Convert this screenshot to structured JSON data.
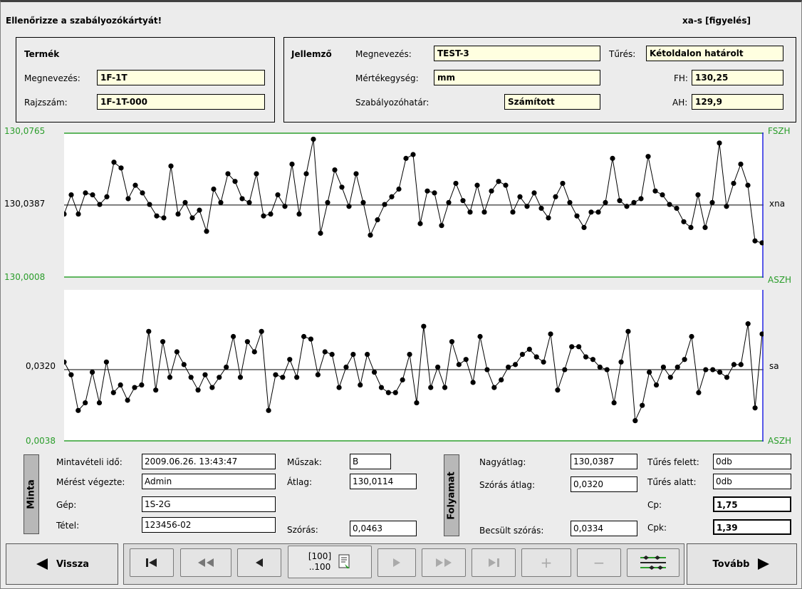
{
  "header": {
    "title": "Ellenőrizze a szabályozókártyát!",
    "mode": "xa-s [figyelés]"
  },
  "product": {
    "heading": "Termék",
    "name_label": "Megnevezés:",
    "name_value": "1F-1T",
    "drawing_label": "Rajzszám:",
    "drawing_value": "1F-1T-000"
  },
  "characteristic": {
    "heading": "Jellemző",
    "name_label": "Megnevezés:",
    "name_value": "TEST-3",
    "unit_label": "Mértékegység:",
    "unit_value": "mm",
    "limit_label": "Szabályozóhatár:",
    "limit_value": "Számított",
    "tolerance_label": "Tűrés:",
    "tolerance_value": "Kétoldalon határolt",
    "fh_label": "FH:",
    "fh_value": "130,25",
    "ah_label": "AH:",
    "ah_value": "129,9"
  },
  "charts": {
    "xbar": {
      "top_label": "130,0765",
      "mid_label": "130,0387",
      "bottom_label": "130,0008",
      "right_top": "FSZH",
      "right_mid": "xna",
      "right_bottom": "ASZH"
    },
    "s": {
      "mid_label": "0,0320",
      "bottom_label": "0,0038",
      "right_mid": "sa",
      "right_bottom": "ASZH"
    }
  },
  "chart_data": [
    {
      "type": "line",
      "ylim": [
        130.0008,
        130.0765
      ],
      "centerline": 130.0387,
      "values": [
        130.034,
        130.044,
        130.034,
        130.045,
        130.044,
        130.039,
        130.043,
        130.061,
        130.058,
        130.042,
        130.049,
        130.045,
        130.039,
        130.033,
        130.032,
        130.059,
        130.034,
        130.04,
        130.032,
        130.036,
        130.025,
        130.047,
        130.04,
        130.055,
        130.051,
        130.042,
        130.04,
        130.055,
        130.033,
        130.034,
        130.044,
        130.038,
        130.06,
        130.034,
        130.055,
        130.073,
        130.024,
        130.04,
        130.057,
        130.048,
        130.038,
        130.055,
        130.04,
        130.023,
        130.031,
        130.039,
        130.043,
        130.047,
        130.063,
        130.065,
        130.029,
        130.046,
        130.045,
        130.028,
        130.04,
        130.05,
        130.041,
        130.035,
        130.049,
        130.035,
        130.046,
        130.051,
        130.049,
        130.035,
        130.043,
        130.038,
        130.045,
        130.037,
        130.032,
        130.043,
        130.05,
        130.04,
        130.033,
        130.027,
        130.035,
        130.035,
        130.04,
        130.063,
        130.041,
        130.038,
        130.04,
        130.042,
        130.064,
        130.046,
        130.044,
        130.039,
        130.037,
        130.03,
        130.027,
        130.044,
        130.027,
        130.04,
        130.071,
        130.038,
        130.05,
        130.06,
        130.049,
        130.02,
        130.019
      ]
    },
    {
      "type": "line",
      "ylim": [
        0.0038,
        0.0633
      ],
      "centerline": 0.032,
      "values": [
        0.035,
        0.03,
        0.016,
        0.019,
        0.031,
        0.019,
        0.035,
        0.023,
        0.026,
        0.02,
        0.025,
        0.026,
        0.047,
        0.024,
        0.043,
        0.029,
        0.039,
        0.034,
        0.029,
        0.024,
        0.03,
        0.025,
        0.029,
        0.033,
        0.045,
        0.029,
        0.043,
        0.039,
        0.047,
        0.016,
        0.03,
        0.029,
        0.036,
        0.029,
        0.045,
        0.044,
        0.03,
        0.039,
        0.038,
        0.025,
        0.033,
        0.038,
        0.026,
        0.038,
        0.031,
        0.025,
        0.023,
        0.023,
        0.028,
        0.038,
        0.019,
        0.049,
        0.025,
        0.033,
        0.025,
        0.043,
        0.034,
        0.036,
        0.027,
        0.045,
        0.032,
        0.025,
        0.028,
        0.033,
        0.034,
        0.038,
        0.04,
        0.037,
        0.035,
        0.046,
        0.024,
        0.032,
        0.041,
        0.041,
        0.037,
        0.036,
        0.033,
        0.032,
        0.019,
        0.035,
        0.047,
        0.012,
        0.018,
        0.031,
        0.026,
        0.033,
        0.029,
        0.033,
        0.036,
        0.045,
        0.023,
        0.032,
        0.032,
        0.031,
        0.029,
        0.034,
        0.034,
        0.05,
        0.017,
        0.046
      ]
    }
  ],
  "sample": {
    "tab_label": "Minta",
    "time_label": "Mintavételi idő:",
    "time_value": "2009.06.26. 13:43:47",
    "operator_label": "Mérést végezte:",
    "operator_value": "Admin",
    "machine_label": "Gép:",
    "machine_value": "1S-2G",
    "lot_label": "Tétel:",
    "lot_value": "123456-02",
    "shift_label": "Műszak:",
    "shift_value": "B",
    "mean_label": "Átlag:",
    "mean_value": "130,0114",
    "std_label": "Szórás:",
    "std_value": "0,0463"
  },
  "process": {
    "tab_label": "Folyamat",
    "grand_mean_label": "Nagyátlag:",
    "grand_mean_value": "130,0387",
    "std_mean_label": "Szórás átlag:",
    "std_mean_value": "0,0320",
    "est_std_label": "Becsült szórás:",
    "est_std_value": "0,0334",
    "over_label": "Tűrés felett:",
    "over_value": "0db",
    "under_label": "Tűrés alatt:",
    "under_value": "0db",
    "cp_label": "Cp:",
    "cp_value": "1,75",
    "cpk_label": "Cpk:",
    "cpk_value": "1,39"
  },
  "nav": {
    "back_label": "Vissza",
    "next_label": "Tovább",
    "counter_line1": "[100]",
    "counter_line2": "..100"
  }
}
